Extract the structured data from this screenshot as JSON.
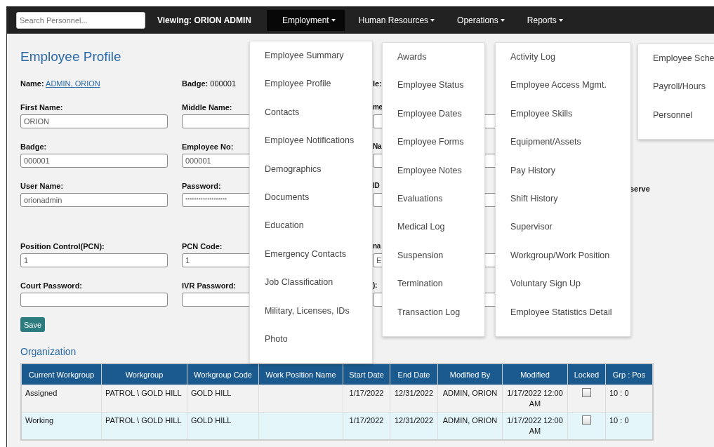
{
  "navbar": {
    "search": {
      "placeholder": "Search Personnel..."
    },
    "viewing": "Viewing: ORION ADMIN",
    "items": [
      {
        "label": "Employment",
        "selected": true
      },
      {
        "label": "Human Resources",
        "selected": false
      },
      {
        "label": "Operations",
        "selected": false
      },
      {
        "label": "Reports",
        "selected": false
      }
    ]
  },
  "page_title": "Employee Profile",
  "info_row": [
    {
      "kind": "link",
      "label": "Name:",
      "value": "ADMIN, ORION"
    },
    {
      "kind": "text",
      "label": "Badge:",
      "value": "000001"
    },
    {
      "kind": "label",
      "label": "le:"
    }
  ],
  "form_rows": [
    {
      "cells": [
        {
          "kind": "input",
          "label": "First Name:",
          "value": "ORION"
        },
        {
          "kind": "input",
          "label": "Middle Name:"
        },
        {
          "kind": "input",
          "label": "me"
        }
      ]
    },
    {
      "cells": [
        {
          "kind": "input",
          "label": "Badge:",
          "value": "000001"
        },
        {
          "kind": "input",
          "label": "Employee No:",
          "value": "000001"
        },
        {
          "kind": "input",
          "label": "Na"
        }
      ]
    },
    {
      "cells": [
        {
          "kind": "input",
          "label": "User Name:",
          "value": "orionadmin"
        },
        {
          "kind": "input",
          "label": "Password:",
          "value": "*******************"
        },
        {
          "kind": "input",
          "label": "ID"
        },
        {
          "kind": "note",
          "value": "serve"
        }
      ]
    },
    {
      "cells": [
        {
          "kind": "input",
          "label": "Position Control(PCN):",
          "value": "1"
        },
        {
          "kind": "input",
          "label": "PCN Code:",
          "value": "1"
        },
        {
          "kind": "input",
          "label": "na",
          "value": "E"
        }
      ]
    },
    {
      "cells": [
        {
          "kind": "input",
          "label": "Court Password:"
        },
        {
          "kind": "input",
          "label": "IVR Password:"
        },
        {
          "kind": "input",
          "label": "):"
        }
      ]
    }
  ],
  "save_button": "Save",
  "organization": {
    "title": "Organization",
    "columns": [
      "Current Workgroup",
      "Workgroup",
      "Workgroup Code",
      "Work Position Name",
      "Start Date",
      "End Date",
      "Modified By",
      "Modified",
      "Locked",
      "Grp : Pos"
    ],
    "rows": [
      {
        "current_workgroup": "Assigned",
        "workgroup": "PATROL \\ GOLD HILL",
        "workgroup_code": "GOLD HILL",
        "start_date": "1/17/2022",
        "end_date": "12/31/2022",
        "modified_by": "ADMIN, ORION",
        "modified": "1/17/2022 12:00 AM",
        "locked": false,
        "grp_pos": "10 : 0"
      },
      {
        "current_workgroup": "Working",
        "workgroup": "PATROL \\ GOLD HILL",
        "workgroup_code": "GOLD HILL",
        "start_date": "1/17/2022",
        "end_date": "12/31/2022",
        "modified_by": "ADMIN, ORION",
        "modified": "1/17/2022 12:00 AM",
        "locked": false,
        "grp_pos": "10 : 0"
      }
    ]
  },
  "employment_menu": {
    "columns": [
      [
        "Employee Summary",
        "Employee Profile",
        "Contacts",
        "Employee Notifications",
        "Demographics",
        "Documents",
        "Education",
        "Emergency Contacts",
        "Job Classification",
        "Military, Licenses, IDs",
        "Photo"
      ],
      [
        "Awards",
        "Employee Status",
        "Employee Dates",
        "Employee Forms",
        "Employee Notes",
        "Evaluations",
        "Medical Log",
        "Suspension",
        "Termination",
        "Transaction Log"
      ],
      [
        "Activity Log",
        "Employee Access Mgmt.",
        "Employee Skills",
        "Equipment/Assets",
        "Pay History",
        "Shift History",
        "Supervisor",
        "Workgroup/Work Position",
        "Voluntary Sign Up",
        "Employee Statistics Detail"
      ],
      [
        "Employee Sche",
        "Payroll/Hours",
        "Personnel"
      ]
    ]
  }
}
